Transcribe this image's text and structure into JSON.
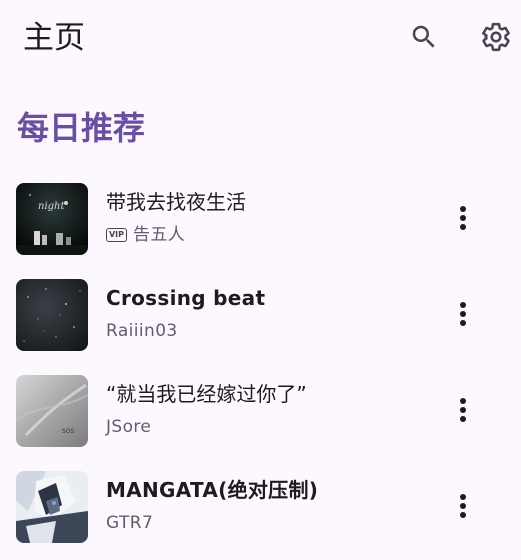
{
  "topbar": {
    "title": "主页",
    "search_icon": "search-icon",
    "settings_icon": "gear-icon"
  },
  "section": {
    "title": "每日推荐"
  },
  "songs": [
    {
      "title": "带我去找夜生活",
      "artist": "告五人",
      "vip": true,
      "vip_label": "VIP",
      "cover": "night-party-cover"
    },
    {
      "title": "Crossing beat",
      "artist": "Raiiin03",
      "vip": false,
      "cover": "starry-dark-cover"
    },
    {
      "title": "“就当我已经嫁过你了”",
      "artist": "JSore",
      "vip": false,
      "cover": "gray-texture-cover"
    },
    {
      "title": "MANGATA(绝对压制)",
      "artist": "GTR7",
      "vip": false,
      "cover": "anime-character-cover"
    }
  ],
  "colors": {
    "background": "#fdf7ff",
    "accent": "#6750a4",
    "text_primary": "#1d1b20",
    "text_secondary": "#625b71"
  }
}
